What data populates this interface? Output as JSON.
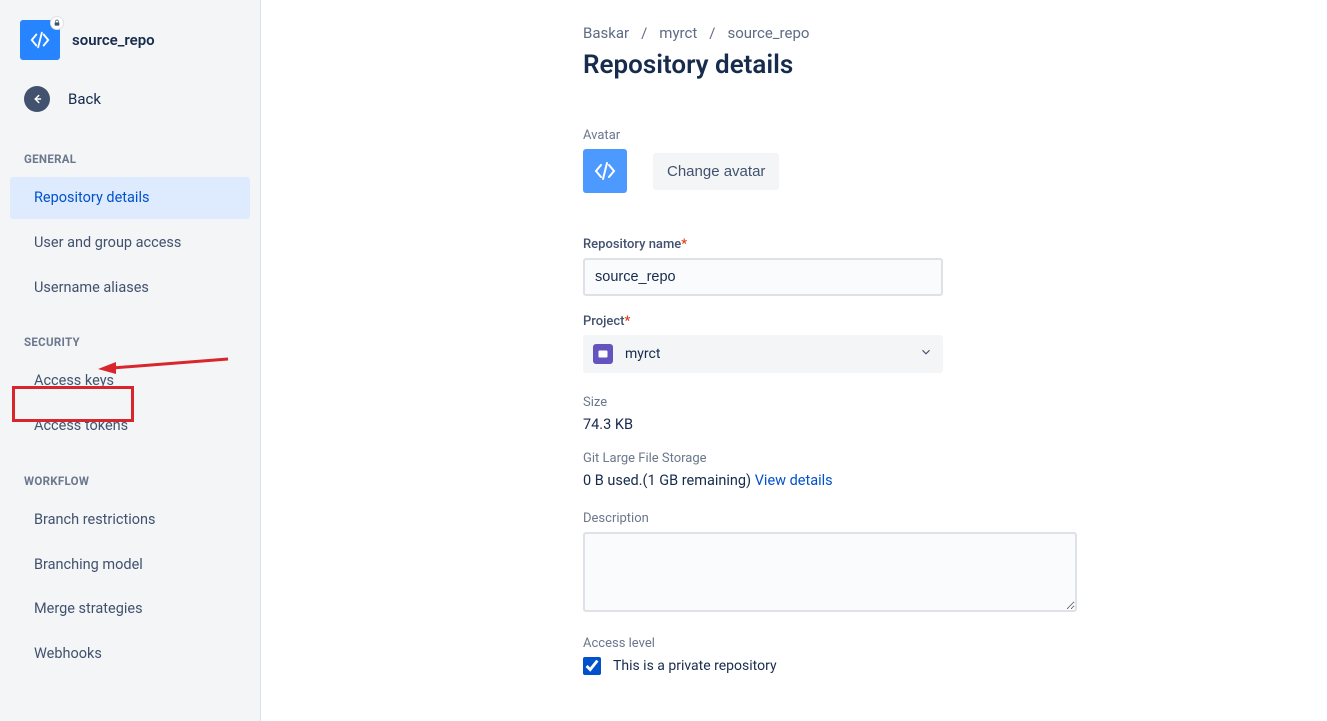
{
  "sidebar": {
    "repo_name": "source_repo",
    "back_label": "Back",
    "sections": {
      "general": {
        "heading": "GENERAL",
        "items": [
          "Repository details",
          "User and group access",
          "Username aliases"
        ]
      },
      "security": {
        "heading": "SECURITY",
        "items": [
          "Access keys",
          "Access tokens"
        ]
      },
      "workflow": {
        "heading": "WORKFLOW",
        "items": [
          "Branch restrictions",
          "Branching model",
          "Merge strategies",
          "Webhooks"
        ]
      }
    }
  },
  "breadcrumb": {
    "parts": [
      "Baskar",
      "myrct",
      "source_repo"
    ]
  },
  "main": {
    "title": "Repository details",
    "avatar_label": "Avatar",
    "change_avatar_btn": "Change avatar",
    "repo_name_label": "Repository name",
    "repo_name_value": "source_repo",
    "project_label": "Project",
    "project_value": "myrct",
    "size_label": "Size",
    "size_value": "74.3 KB",
    "lfs_label": "Git Large File Storage",
    "lfs_used": "0 B used.(1 GB remaining) ",
    "lfs_link": "View details",
    "description_label": "Description",
    "access_level_label": "Access level",
    "private_checkbox_label": "This is a private repository"
  },
  "colors": {
    "accent": "#0052cc",
    "sidebar_bg": "#f4f5f7",
    "annotation": "#d8262c"
  }
}
